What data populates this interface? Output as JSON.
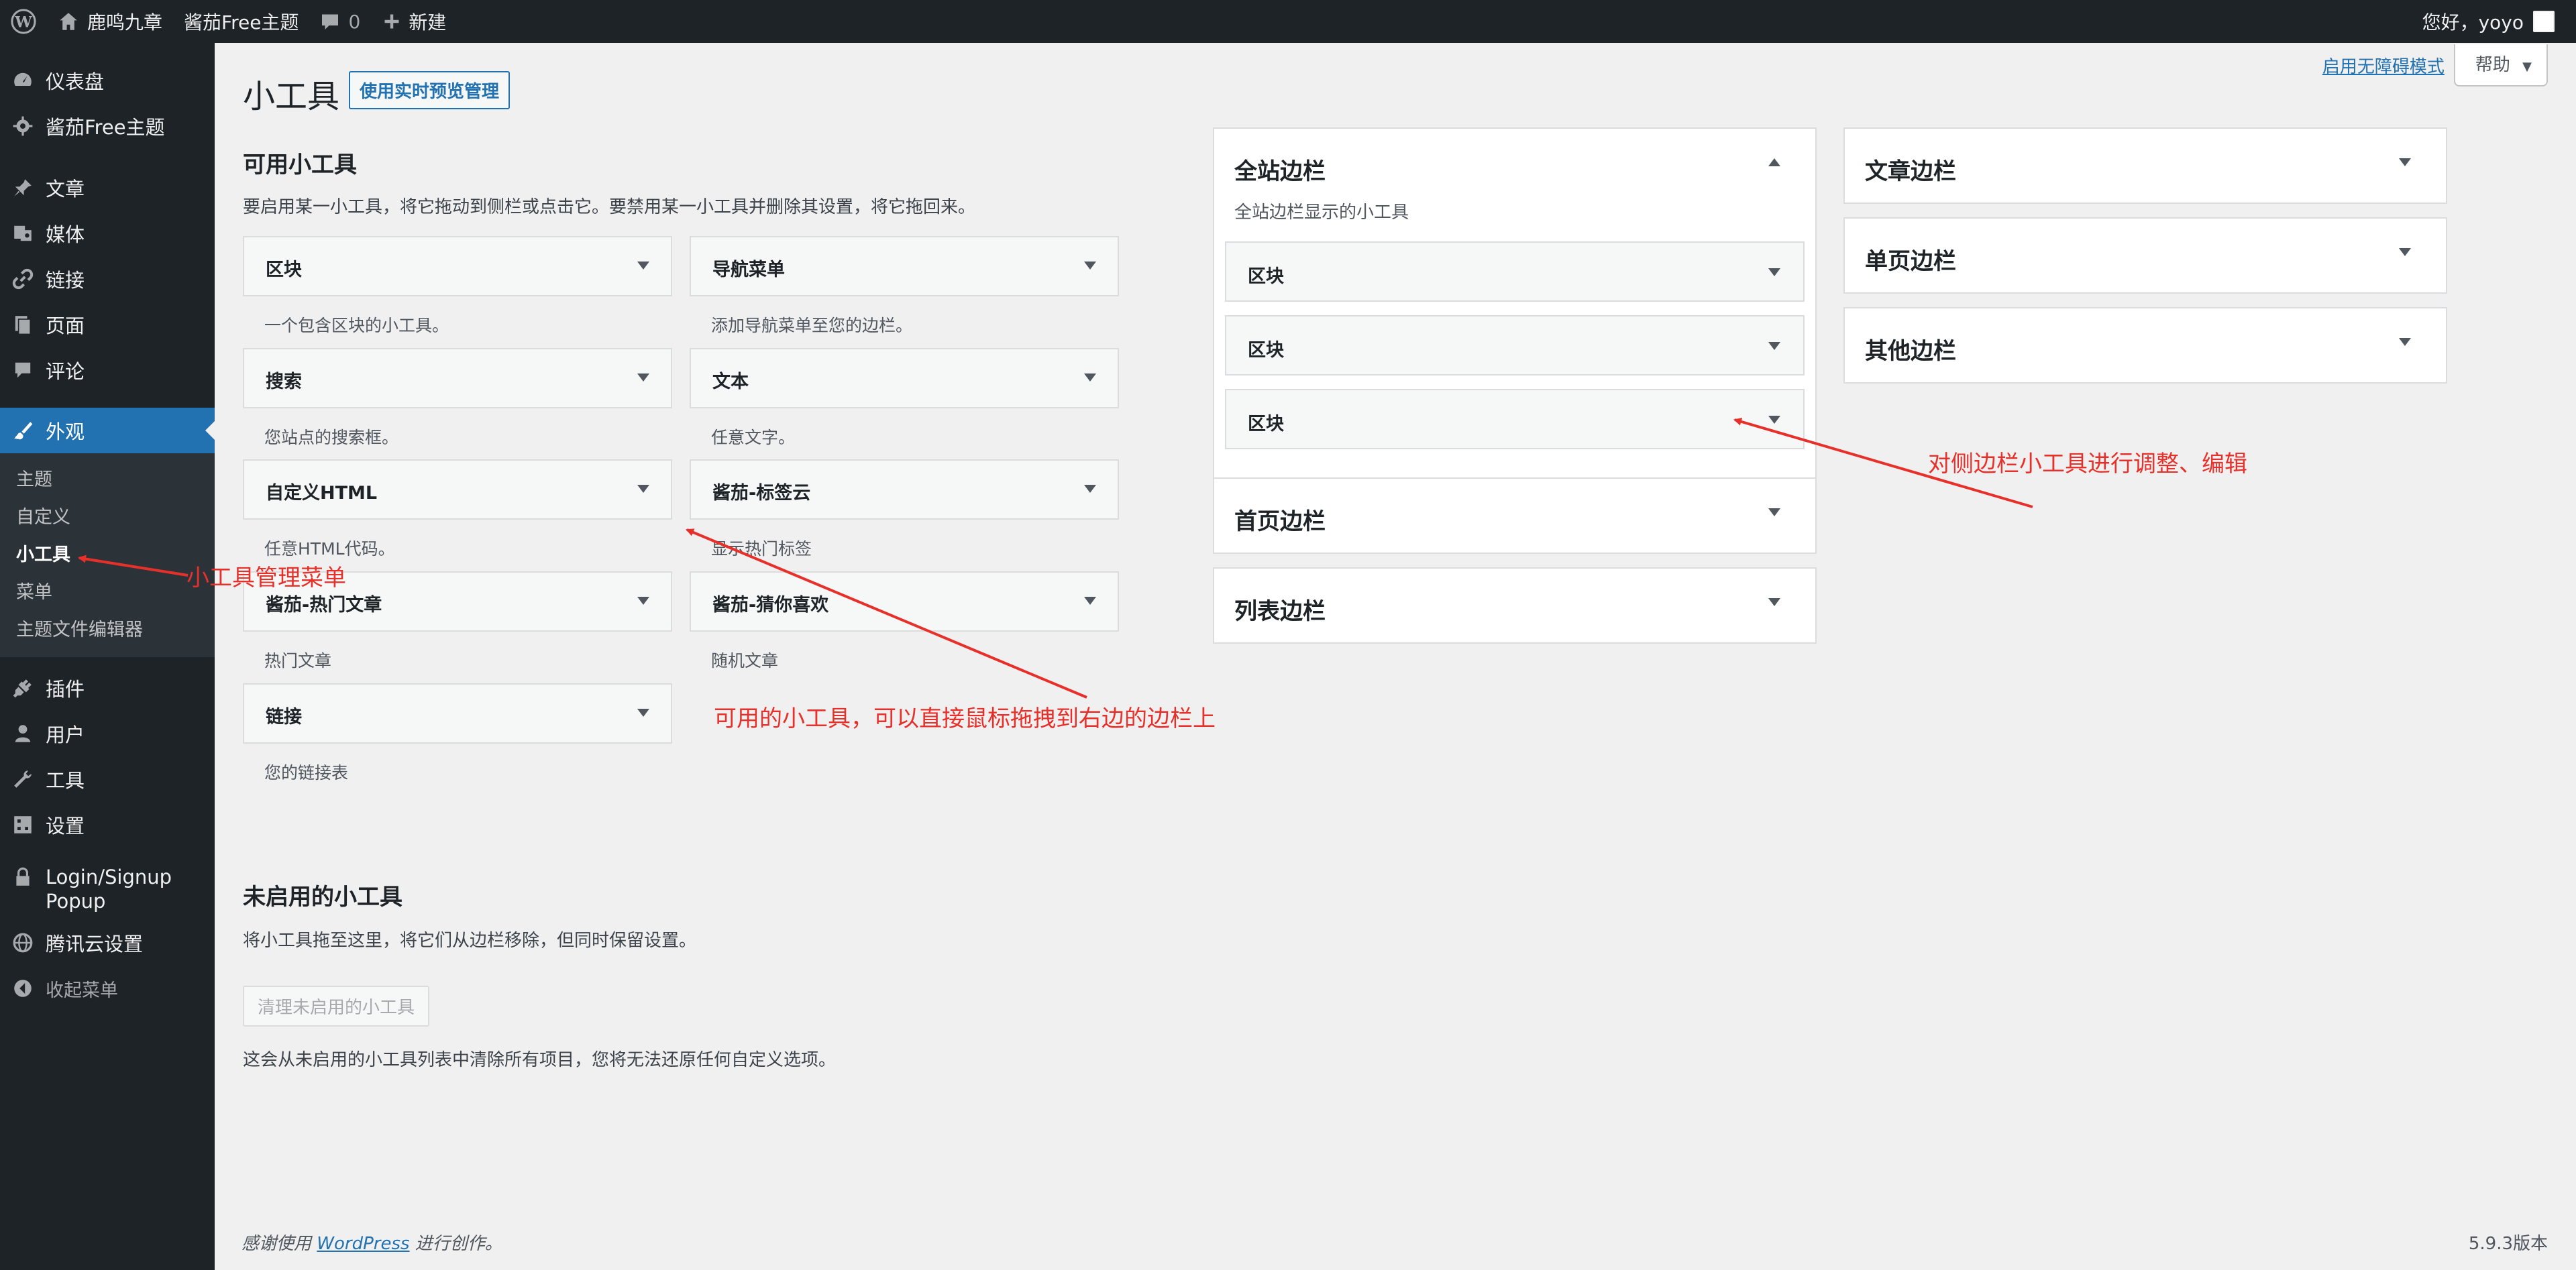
{
  "adminbar": {
    "site_name": "鹿鸣九章",
    "theme_link": "酱茄Free主题",
    "comments_count": "0",
    "new_label": "新建",
    "greeting": "您好，yoyo"
  },
  "sidebar": {
    "items": [
      {
        "label": "仪表盘",
        "icon": "dashboard-icon"
      },
      {
        "label": "酱茄Free主题",
        "icon": "gear-icon"
      },
      {
        "label": "文章",
        "icon": "pin-icon"
      },
      {
        "label": "媒体",
        "icon": "media-icon"
      },
      {
        "label": "链接",
        "icon": "link-icon"
      },
      {
        "label": "页面",
        "icon": "page-icon"
      },
      {
        "label": "评论",
        "icon": "comment-icon"
      },
      {
        "label": "外观",
        "icon": "brush-icon"
      },
      {
        "label": "插件",
        "icon": "plugin-icon"
      },
      {
        "label": "用户",
        "icon": "user-icon"
      },
      {
        "label": "工具",
        "icon": "wrench-icon"
      },
      {
        "label": "设置",
        "icon": "settings-icon"
      },
      {
        "label": "Login/Signup Popup",
        "icon": "lock-icon"
      },
      {
        "label": "腾讯云设置",
        "icon": "globe-icon"
      },
      {
        "label": "收起菜单",
        "icon": "collapse-icon"
      }
    ],
    "submenu": [
      "主题",
      "自定义",
      "小工具",
      "菜单",
      "主题文件编辑器"
    ]
  },
  "screen_meta": {
    "a11y_link": "启用无障碍模式",
    "help": "帮助"
  },
  "page": {
    "title": "小工具",
    "preview_button": "使用实时预览管理"
  },
  "available": {
    "title": "可用小工具",
    "desc": "要启用某一小工具，将它拖动到侧栏或点击它。要禁用某一小工具并删除其设置，将它拖回来。",
    "widgets": [
      {
        "title": "区块",
        "desc": "一个包含区块的小工具。"
      },
      {
        "title": "导航菜单",
        "desc": "添加导航菜单至您的边栏。"
      },
      {
        "title": "搜索",
        "desc": "您站点的搜索框。"
      },
      {
        "title": "文本",
        "desc": "任意文字。"
      },
      {
        "title": "自定义HTML",
        "desc": "任意HTML代码。"
      },
      {
        "title": "酱茄-标签云",
        "desc": "显示热门标签"
      },
      {
        "title": "酱茄-热门文章",
        "desc": "热门文章"
      },
      {
        "title": "酱茄-猜你喜欢",
        "desc": "随机文章"
      },
      {
        "title": "链接",
        "desc": "您的链接表"
      }
    ]
  },
  "inactive": {
    "title": "未启用的小工具",
    "desc": "将小工具拖至这里，将它们从边栏移除，但同时保留设置。",
    "clear_button": "清理未启用的小工具",
    "note": "这会从未启用的小工具列表中清除所有项目，您将无法还原任何自定义选项。"
  },
  "sidebars": {
    "site": {
      "title": "全站边栏",
      "desc": "全站边栏显示的小工具",
      "widgets": [
        "区块",
        "区块",
        "区块"
      ]
    },
    "home": {
      "title": "首页边栏"
    },
    "list": {
      "title": "列表边栏"
    },
    "article": {
      "title": "文章边栏"
    },
    "single": {
      "title": "单页边栏"
    },
    "other": {
      "title": "其他边栏"
    }
  },
  "annotations": {
    "menu": "小工具管理菜单",
    "drag": "可用的小工具，可以直接鼠标拖拽到右边的边栏上",
    "edit": "对侧边栏小工具进行调整、编辑",
    "color": "#e8302a"
  },
  "footer": {
    "thanks_prefix": "感谢使用",
    "wordpress": "WordPress",
    "thanks_suffix": "进行创作。",
    "version": "5.9.3版本"
  }
}
